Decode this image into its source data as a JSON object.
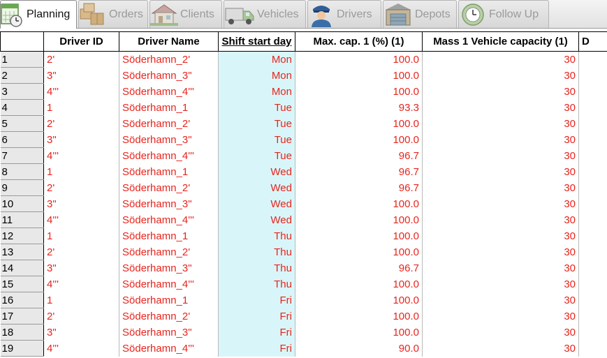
{
  "tabs": [
    {
      "label": "Planning",
      "icon": "calendar-icon",
      "active": true
    },
    {
      "label": "Orders",
      "icon": "boxes-icon",
      "active": false
    },
    {
      "label": "Clients",
      "icon": "house-icon",
      "active": false
    },
    {
      "label": "Vehicles",
      "icon": "truck-icon",
      "active": false
    },
    {
      "label": "Drivers",
      "icon": "driver-icon",
      "active": false
    },
    {
      "label": "Depots",
      "icon": "depot-icon",
      "active": false
    },
    {
      "label": "Follow Up",
      "icon": "clock-icon",
      "active": false
    }
  ],
  "table": {
    "columns": [
      "",
      "Driver ID",
      "Driver Name",
      "Shift start day",
      "Max. cap. 1 (%) (1)",
      "Mass 1 Vehicle capacity (1)",
      "D"
    ],
    "sorted_column": "Shift start day",
    "rows": [
      {
        "n": "1",
        "id": "2'",
        "name": "Söderhamn_2'",
        "day": "Mon",
        "cap": "100.0",
        "mass": "30"
      },
      {
        "n": "2",
        "id": "3\"",
        "name": "Söderhamn_3\"",
        "day": "Mon",
        "cap": "100.0",
        "mass": "30"
      },
      {
        "n": "3",
        "id": "4'''",
        "name": "Söderhamn_4'''",
        "day": "Mon",
        "cap": "100.0",
        "mass": "30"
      },
      {
        "n": "4",
        "id": "1",
        "name": "Söderhamn_1",
        "day": "Tue",
        "cap": "93.3",
        "mass": "30"
      },
      {
        "n": "5",
        "id": "2'",
        "name": "Söderhamn_2'",
        "day": "Tue",
        "cap": "100.0",
        "mass": "30"
      },
      {
        "n": "6",
        "id": "3\"",
        "name": "Söderhamn_3\"",
        "day": "Tue",
        "cap": "100.0",
        "mass": "30"
      },
      {
        "n": "7",
        "id": "4'''",
        "name": "Söderhamn_4'''",
        "day": "Tue",
        "cap": "96.7",
        "mass": "30"
      },
      {
        "n": "8",
        "id": "1",
        "name": "Söderhamn_1",
        "day": "Wed",
        "cap": "96.7",
        "mass": "30"
      },
      {
        "n": "9",
        "id": "2'",
        "name": "Söderhamn_2'",
        "day": "Wed",
        "cap": "96.7",
        "mass": "30"
      },
      {
        "n": "10",
        "id": "3\"",
        "name": "Söderhamn_3\"",
        "day": "Wed",
        "cap": "100.0",
        "mass": "30"
      },
      {
        "n": "11",
        "id": "4'''",
        "name": "Söderhamn_4'''",
        "day": "Wed",
        "cap": "100.0",
        "mass": "30"
      },
      {
        "n": "12",
        "id": "1",
        "name": "Söderhamn_1",
        "day": "Thu",
        "cap": "100.0",
        "mass": "30"
      },
      {
        "n": "13",
        "id": "2'",
        "name": "Söderhamn_2'",
        "day": "Thu",
        "cap": "100.0",
        "mass": "30"
      },
      {
        "n": "14",
        "id": "3\"",
        "name": "Söderhamn_3\"",
        "day": "Thu",
        "cap": "96.7",
        "mass": "30"
      },
      {
        "n": "15",
        "id": "4'''",
        "name": "Söderhamn_4'''",
        "day": "Thu",
        "cap": "100.0",
        "mass": "30"
      },
      {
        "n": "16",
        "id": "1",
        "name": "Söderhamn_1",
        "day": "Fri",
        "cap": "100.0",
        "mass": "30"
      },
      {
        "n": "17",
        "id": "2'",
        "name": "Söderhamn_2'",
        "day": "Fri",
        "cap": "100.0",
        "mass": "30"
      },
      {
        "n": "18",
        "id": "3\"",
        "name": "Söderhamn_3\"",
        "day": "Fri",
        "cap": "100.0",
        "mass": "30"
      },
      {
        "n": "19",
        "id": "4'''",
        "name": "Söderhamn_4'''",
        "day": "Fri",
        "cap": "90.0",
        "mass": "30"
      }
    ]
  },
  "colors": {
    "cell_text": "#e8241d",
    "shift_column_bg": "#d8f6f9",
    "row_header_bg": "#e8e8e8"
  }
}
